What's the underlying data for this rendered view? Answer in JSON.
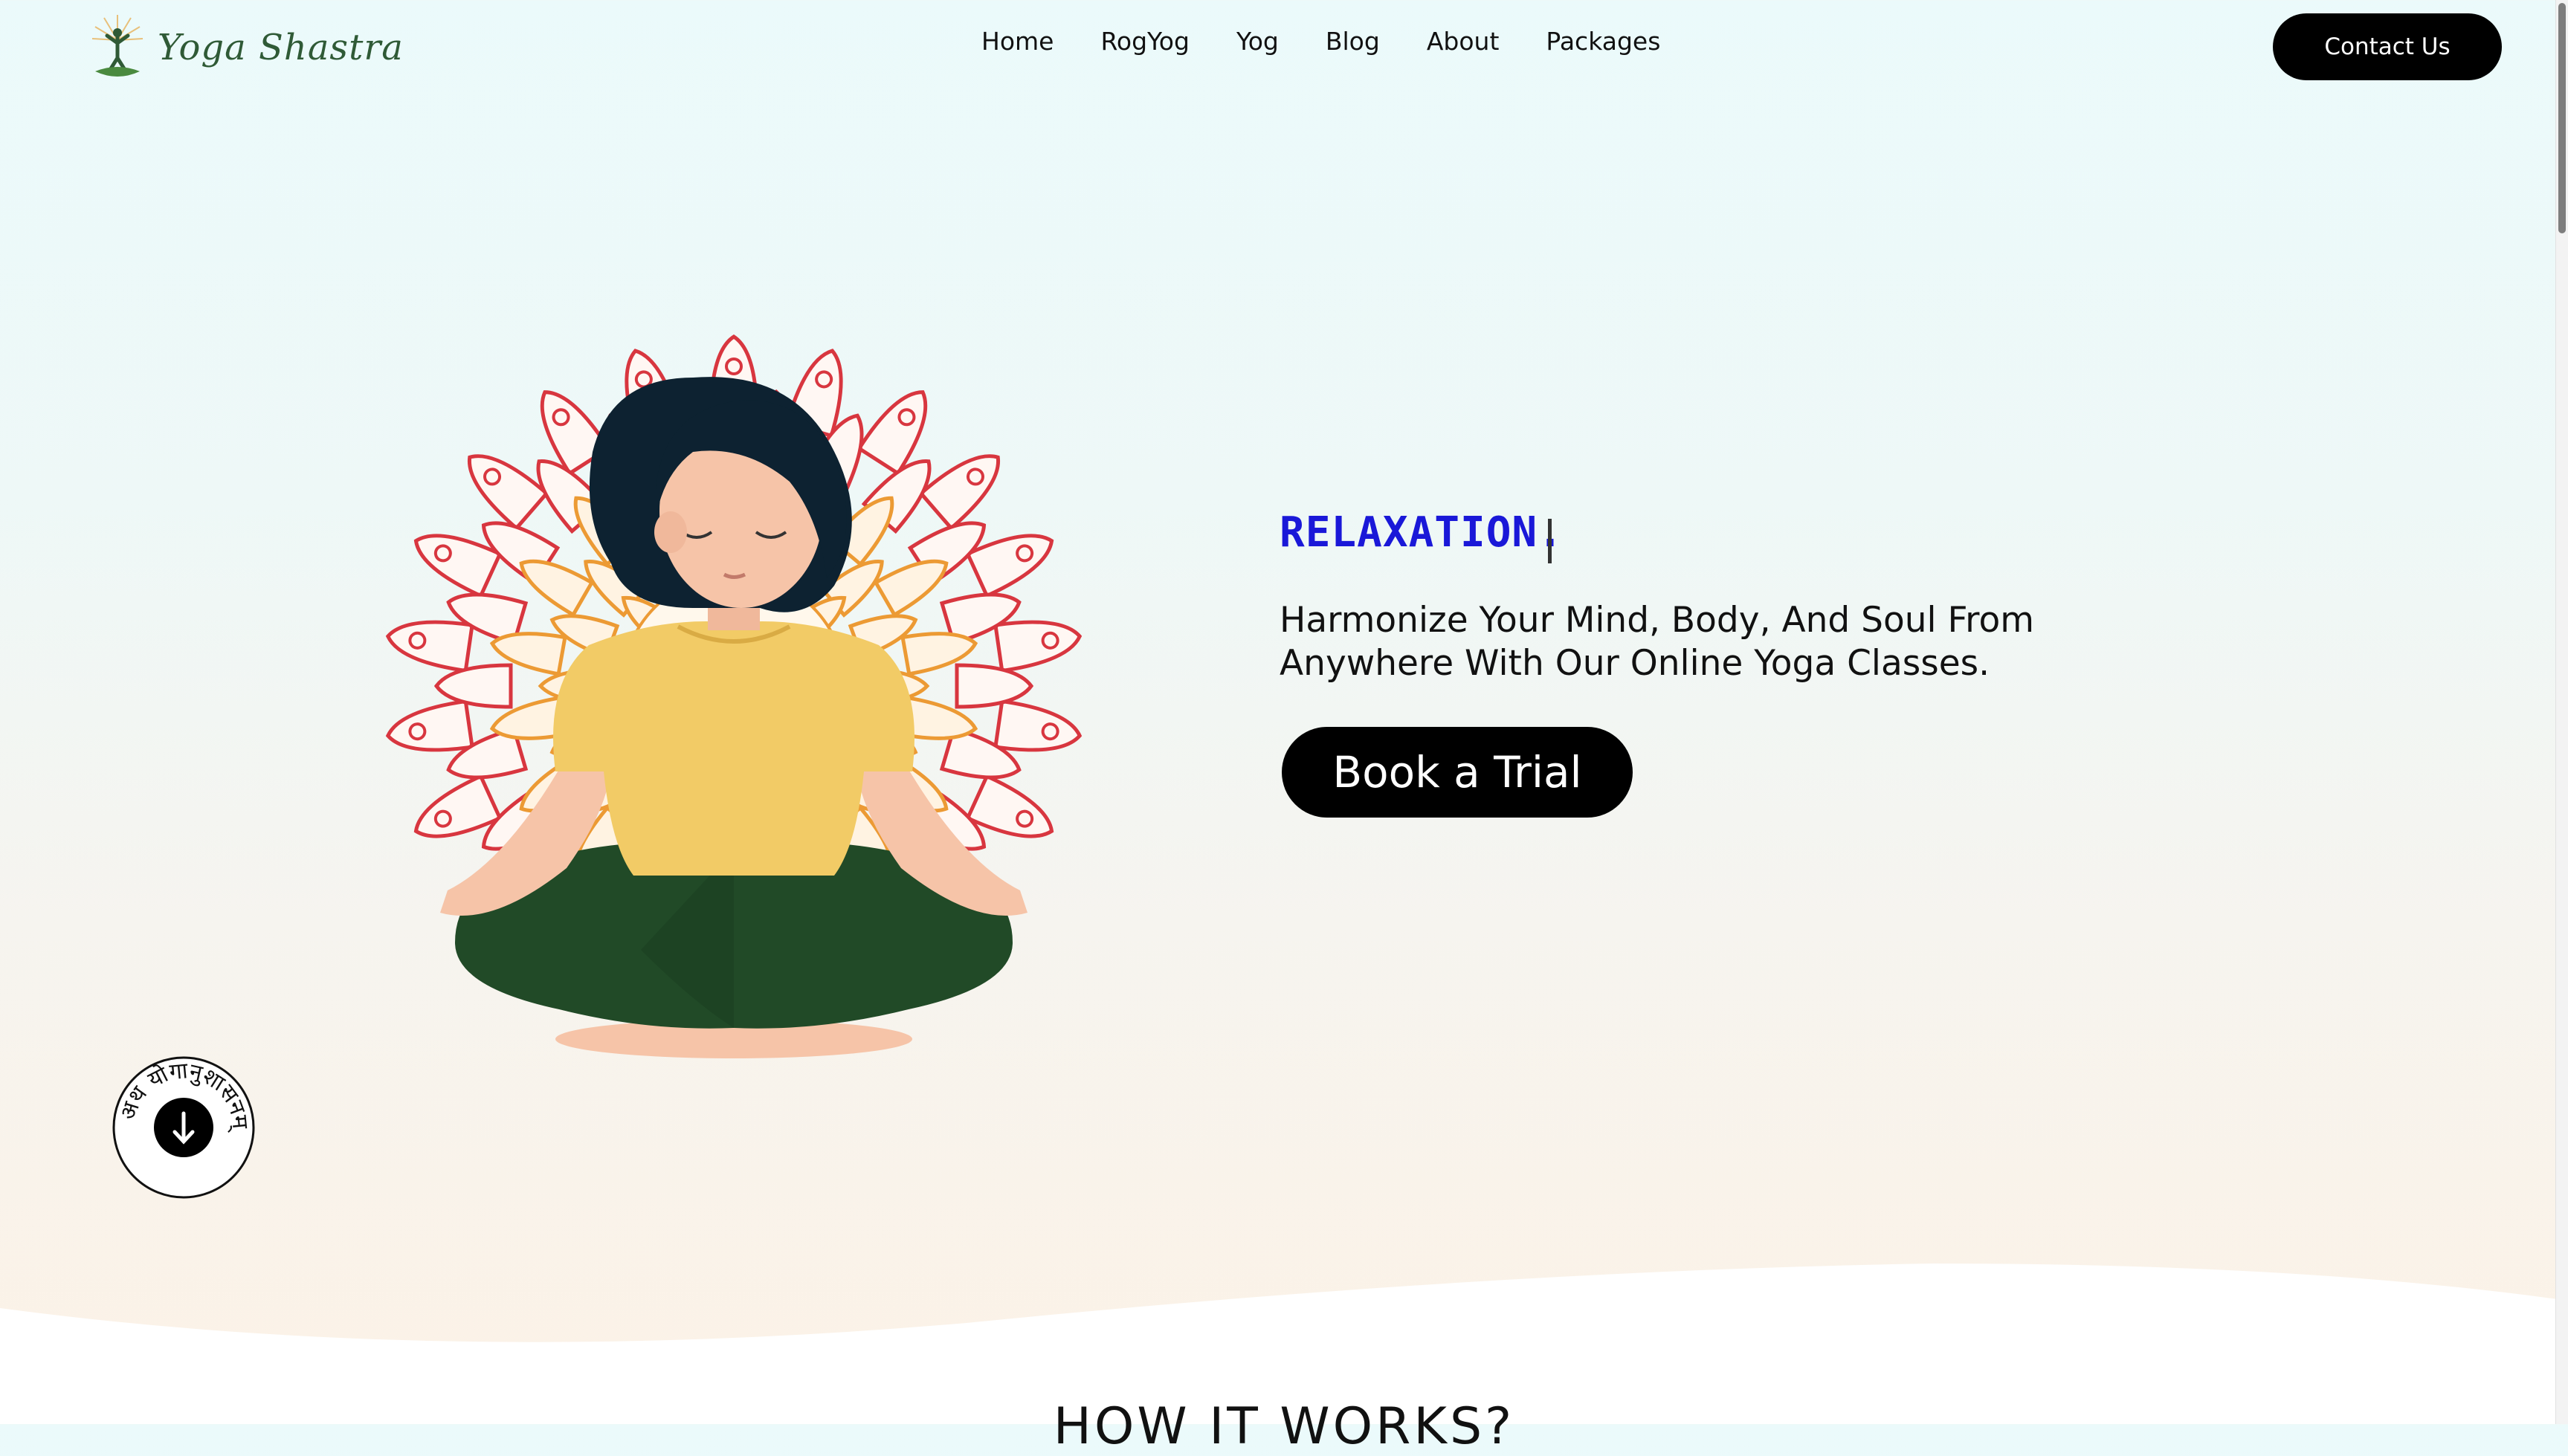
{
  "brand": {
    "name": "Yoga Shastra"
  },
  "nav": {
    "items": [
      {
        "label": "Home"
      },
      {
        "label": "RogYog"
      },
      {
        "label": "Yog"
      },
      {
        "label": "Blog"
      },
      {
        "label": "About"
      },
      {
        "label": "Packages"
      }
    ],
    "contact_label": "Contact Us"
  },
  "hero": {
    "rotating_word": "RELAXATION.",
    "tagline_line1": "Harmonize Your Mind, Body, And Soul From",
    "tagline_line2": "Anywhere With Our Online Yoga Classes.",
    "cta_label": "Book a Trial",
    "illustration": "meditating-woman-mandala"
  },
  "scroll_badge": {
    "text": "अथ योगानुशासनम्",
    "icon": "arrow-down-icon"
  },
  "next_section": {
    "title": "HOW IT WORKS?"
  },
  "colors": {
    "accent_text": "#1a18d8",
    "button": "#000000",
    "mandala_red": "#d8363f",
    "mandala_orange": "#ec9a34"
  }
}
